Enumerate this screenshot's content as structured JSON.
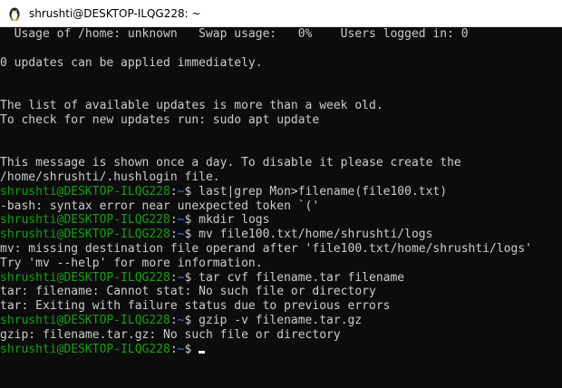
{
  "window": {
    "title": "shrushti@DESKTOP-ILQG228: ~"
  },
  "terminal": {
    "lines": [
      {
        "type": "output",
        "text": "  Usage of /home: unknown   Swap usage:   0%    Users logged in: 0"
      },
      {
        "type": "blank",
        "text": ""
      },
      {
        "type": "output",
        "text": "0 updates can be applied immediately."
      },
      {
        "type": "blank",
        "text": ""
      },
      {
        "type": "blank",
        "text": ""
      },
      {
        "type": "output",
        "text": "The list of available updates is more than a week old."
      },
      {
        "type": "output",
        "text": "To check for new updates run: sudo apt update"
      },
      {
        "type": "blank",
        "text": ""
      },
      {
        "type": "blank",
        "text": ""
      },
      {
        "type": "output",
        "text": "This message is shown once a day. To disable it please create the"
      },
      {
        "type": "output",
        "text": "/home/shrushti/.hushlogin file."
      },
      {
        "type": "prompt",
        "user": "shrushti@DESKTOP-ILQG228",
        "sep": ":",
        "path": "~",
        "symbol": "$ ",
        "command": "last|grep Mon>filename(file100.txt)"
      },
      {
        "type": "output",
        "text": "-bash: syntax error near unexpected token `('"
      },
      {
        "type": "prompt",
        "user": "shrushti@DESKTOP-ILQG228",
        "sep": ":",
        "path": "~",
        "symbol": "$ ",
        "command": "mkdir logs"
      },
      {
        "type": "prompt",
        "user": "shrushti@DESKTOP-ILQG228",
        "sep": ":",
        "path": "~",
        "symbol": "$ ",
        "command": "mv file100.txt/home/shrushti/logs"
      },
      {
        "type": "output",
        "text": "mv: missing destination file operand after 'file100.txt/home/shrushti/logs'"
      },
      {
        "type": "output",
        "text": "Try 'mv --help' for more information."
      },
      {
        "type": "prompt",
        "user": "shrushti@DESKTOP-ILQG228",
        "sep": ":",
        "path": "~",
        "symbol": "$ ",
        "command": "tar cvf filename.tar filename"
      },
      {
        "type": "output",
        "text": "tar: filename: Cannot stat: No such file or directory"
      },
      {
        "type": "output",
        "text": "tar: Exiting with failure status due to previous errors"
      },
      {
        "type": "prompt",
        "user": "shrushti@DESKTOP-ILQG228",
        "sep": ":",
        "path": "~",
        "symbol": "$ ",
        "command": "gzip -v filename.tar.gz"
      },
      {
        "type": "output",
        "text": "gzip: filename.tar.gz: No such file or directory"
      },
      {
        "type": "prompt-active",
        "user": "shrushti@DESKTOP-ILQG228",
        "sep": ":",
        "path": "~",
        "symbol": "$ ",
        "command": ""
      }
    ]
  },
  "colors": {
    "background": "#0c0c0c",
    "text": "#cccccc",
    "prompt_user": "#13a10e",
    "prompt_path": "#3b78ff",
    "titlebar": "#ffffff"
  },
  "icons": {
    "title_icon": "terminal-penguin-icon"
  }
}
